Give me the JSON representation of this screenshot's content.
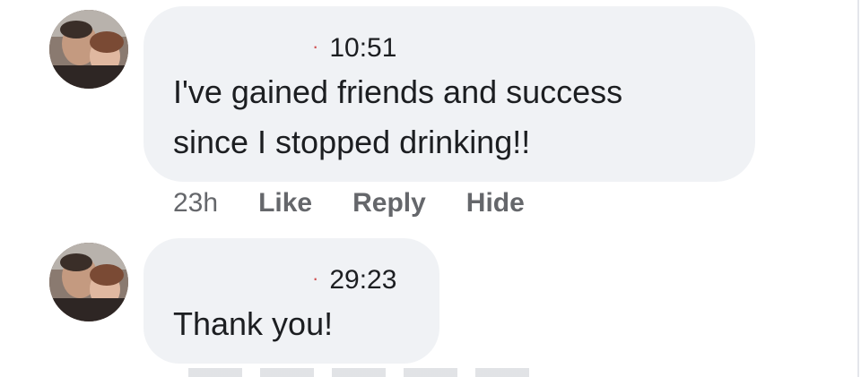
{
  "comments": [
    {
      "time": "10:51",
      "text_line1": "I've gained friends and success",
      "text_line2": "since I stopped drinking!!",
      "dot": "·"
    },
    {
      "time": "29:23",
      "text_line1": "Thank you!",
      "dot": "·"
    }
  ],
  "actions": {
    "age": "23h",
    "like": "Like",
    "reply": "Reply",
    "hide": "Hide"
  },
  "colors": {
    "bubble": "#f0f2f5",
    "action_text": "#65676b",
    "dot": "#d05050"
  }
}
